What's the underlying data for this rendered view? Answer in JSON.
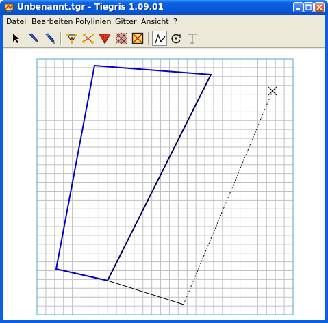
{
  "window": {
    "title": "Unbenannt.tgr - Tiegris 1.09.01",
    "app_icon": "tiegris-app-icon",
    "controls": [
      "minimize-icon",
      "maximize-icon",
      "close-icon"
    ]
  },
  "menubar": {
    "items": [
      "Datei",
      "Bearbeiten",
      "Polylinien",
      "Gitter",
      "Ansicht",
      "?"
    ]
  },
  "toolbar": {
    "tools": [
      {
        "icon": "pointer-arrow-icon"
      },
      {
        "icon": "pen-icon"
      },
      {
        "icon": "multi-pen-icon"
      },
      {
        "icon": "polygon-vertices-icon"
      },
      {
        "icon": "node-points-icon"
      },
      {
        "icon": "fan-triangle-icon"
      },
      {
        "icon": "grid-cross-icon"
      },
      {
        "icon": "frame-cross-icon"
      },
      {
        "icon": "polyline-mode-icon",
        "active": true
      },
      {
        "icon": "rotate-icon"
      },
      {
        "icon": "text-icon",
        "disabled": true
      }
    ]
  },
  "colors": {
    "titlebar": "#0a58d8",
    "grid_line": "#c0c0c0",
    "grid_border": "#4fa8c8",
    "active_polyline": "#0000cc",
    "polyline": "#000000",
    "cursor_marker": "#000000"
  },
  "canvas": {
    "grid_columns": 29,
    "grid_rows": 29
  }
}
